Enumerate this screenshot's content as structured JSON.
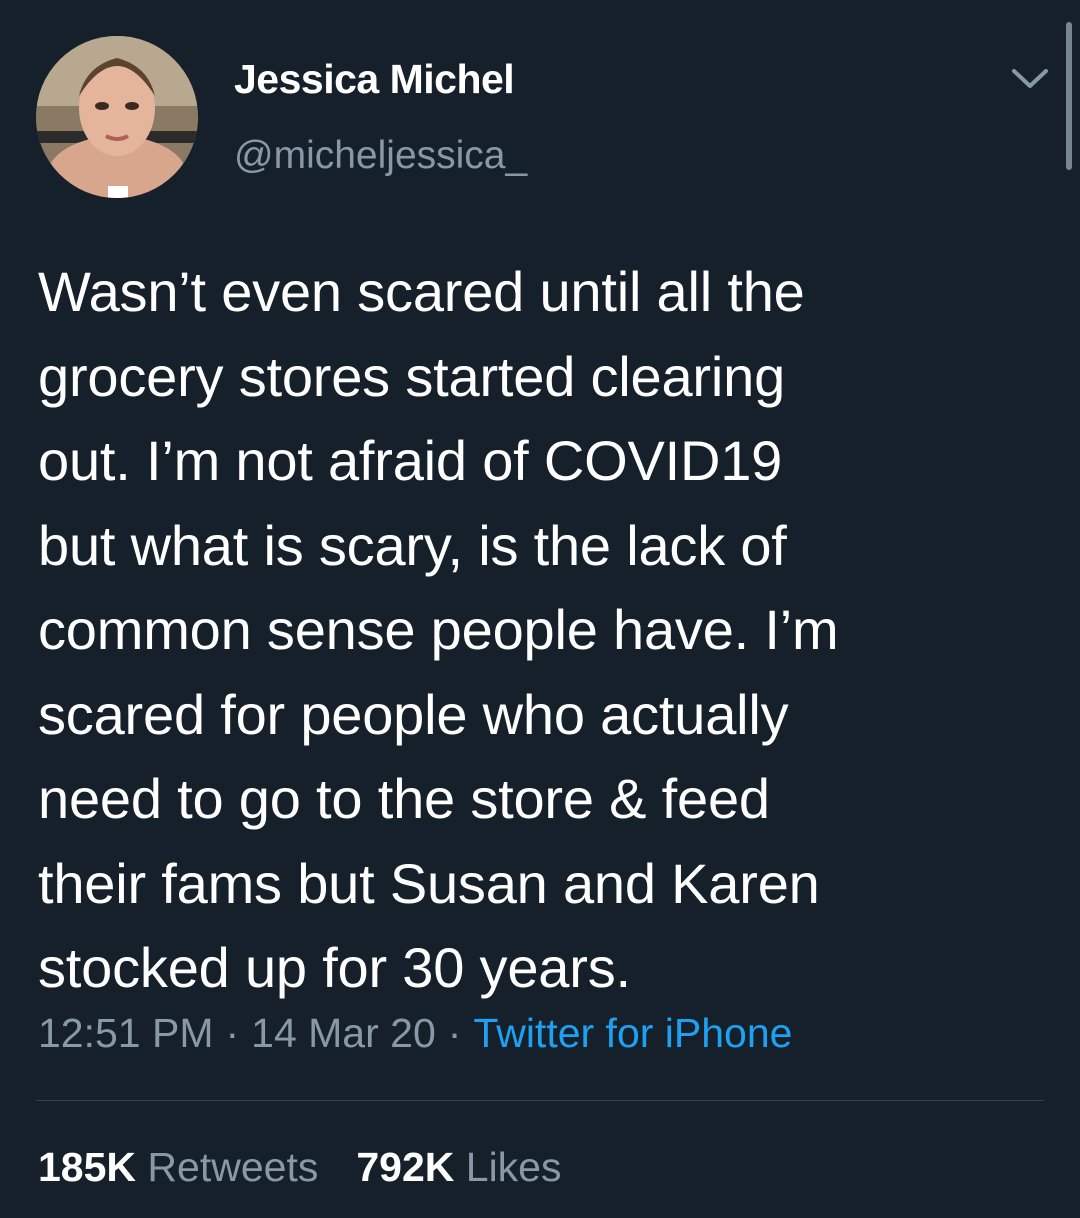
{
  "tweet": {
    "author": {
      "display_name": "Jessica Michel",
      "handle": "@micheljessica_"
    },
    "text": "Wasn’t even scared until all the\ngrocery stores started clearing\nout. I’m not afraid of COVID19\nbut what is scary, is the lack of\ncommon sense people have. I’m\nscared for people who actually\nneed to go to the store & feed\ntheir fams but Susan and Karen\nstocked up for 30 years.",
    "time": "12:51 PM",
    "separator": "·",
    "date": "14 Mar 20",
    "source": "Twitter for iPhone",
    "retweets": {
      "count": "185K",
      "label": "Retweets"
    },
    "likes": {
      "count": "792K",
      "label": "Likes"
    }
  },
  "icons": {
    "more": "chevron-down-icon",
    "avatar": "profile-photo"
  },
  "colors": {
    "background": "#15202b",
    "primary_text": "#ffffff",
    "secondary_text": "#8899a6",
    "link": "#1da1f2",
    "divider": "#38444d"
  }
}
